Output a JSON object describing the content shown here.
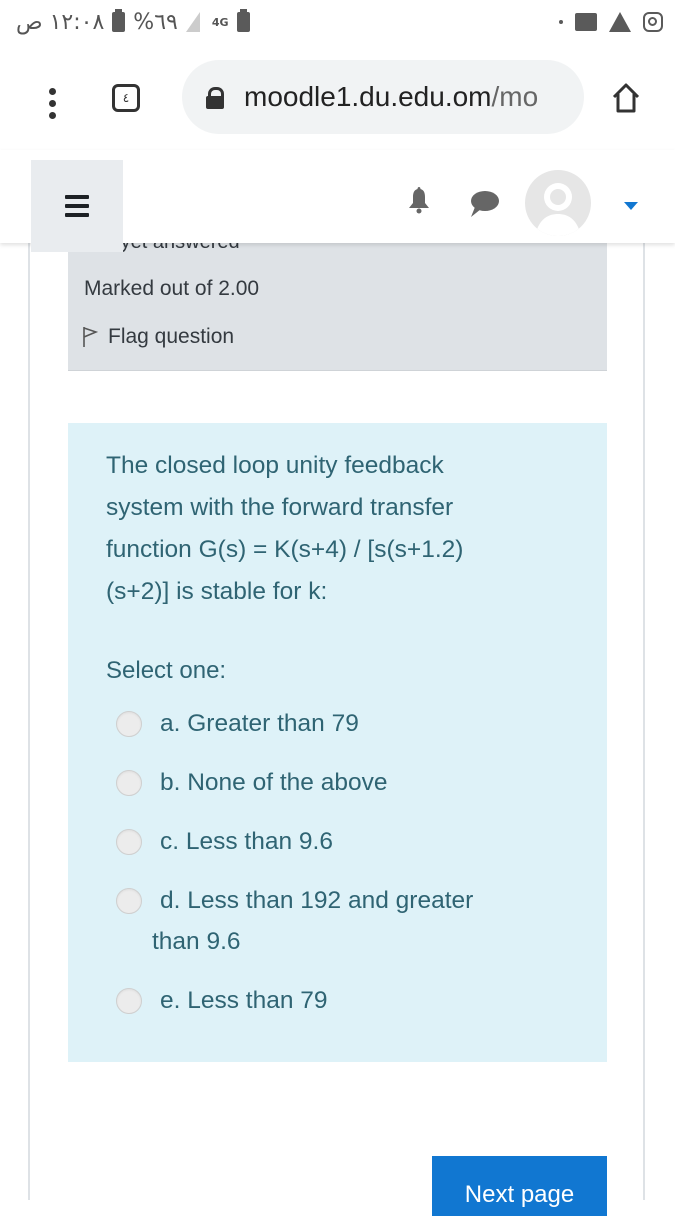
{
  "status_bar": {
    "time": "١٢:٠٨ ص",
    "battery_percent": "%٦٩",
    "network": "4G",
    "left_icons": [
      "battery-saver-icon",
      "signal-icon",
      "network-4g-icon",
      "recycle-battery-icon"
    ],
    "right_icons": [
      "notification-dot-icon",
      "folder-icon",
      "warning-icon",
      "instagram-icon"
    ]
  },
  "browser": {
    "tab_count": "٤",
    "url_host": "moodle1.du.edu.om",
    "url_path": "/mo",
    "icons": [
      "more-vert-icon",
      "tabs-icon",
      "lock-icon",
      "home-icon"
    ]
  },
  "appbar": {
    "icons": [
      "hamburger-menu-icon",
      "bell-icon",
      "chat-icon",
      "avatar",
      "caret-down-icon"
    ]
  },
  "question_info": {
    "state_partial": "Not yet answered",
    "marked": "Marked out of 2.00",
    "flag_label": "Flag question"
  },
  "question": {
    "text": "The closed loop unity feedback system with the forward transfer function G(s) = K(s+4) / [s(s+1.2)(s+2)] is stable for k:",
    "lines": [
      "The closed loop unity feedback",
      "system with the forward transfer",
      "function G(s) = K(s+4) / [s(s+1.2)",
      "(s+2)] is stable for k:"
    ],
    "prompt": "Select one:",
    "options": [
      {
        "label": "a. Greater than 79",
        "selected": false
      },
      {
        "label": "b. None of the above",
        "selected": false
      },
      {
        "label": "c. Less than 9.6",
        "selected": false
      },
      {
        "label": "d. Less than 192 and greater than 9.6",
        "line1": "d. Less than 192 and greater",
        "line2": "than 9.6",
        "selected": false
      },
      {
        "label": "e. Less than 79",
        "selected": false
      }
    ]
  },
  "navigation": {
    "next_label": "Next page"
  },
  "colors": {
    "accent": "#1177d1",
    "question_bg": "#def2f8",
    "question_text": "#2f6473",
    "info_bg": "#dee2e6"
  }
}
